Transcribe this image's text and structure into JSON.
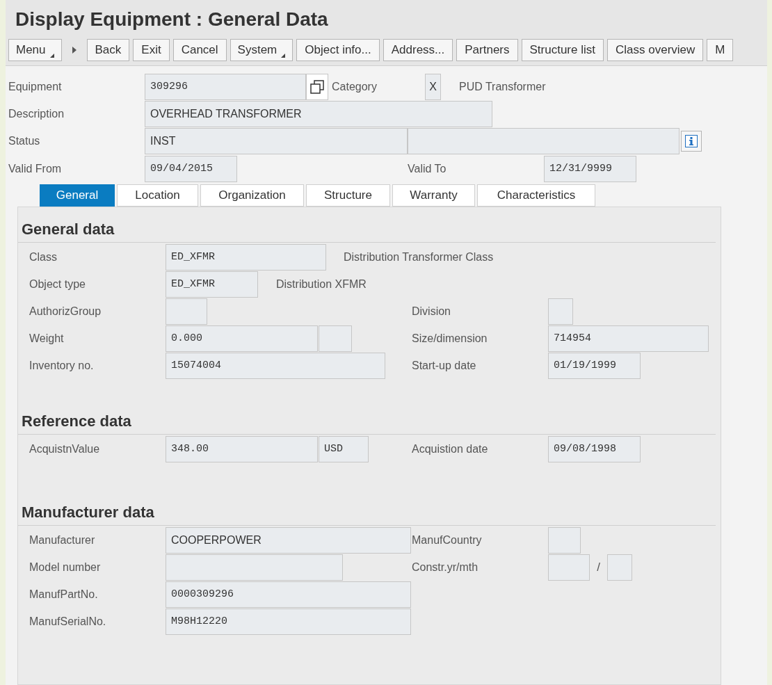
{
  "title": "Display Equipment : General Data",
  "toolbar": [
    {
      "kind": "menu",
      "label": "Menu"
    },
    {
      "kind": "arrow"
    },
    {
      "kind": "button",
      "label": "Back"
    },
    {
      "kind": "button",
      "label": "Exit"
    },
    {
      "kind": "button",
      "label": "Cancel"
    },
    {
      "kind": "menu",
      "label": "System"
    },
    {
      "kind": "button",
      "label": "Object info..."
    },
    {
      "kind": "button",
      "label": "Address..."
    },
    {
      "kind": "button",
      "label": "Partners"
    },
    {
      "kind": "button",
      "label": "Structure list"
    },
    {
      "kind": "button",
      "label": "Class overview"
    },
    {
      "kind": "button",
      "label": "M"
    }
  ],
  "header": {
    "equipment": {
      "label": "Equipment",
      "value": "309296"
    },
    "category": {
      "label": "Category",
      "value": "X",
      "text": "PUD Transformer"
    },
    "description": {
      "label": "Description",
      "value": "OVERHEAD TRANSFORMER"
    },
    "status": {
      "label": "Status",
      "value": "INST"
    },
    "valid_from": {
      "label": "Valid From",
      "value": "09/04/2015"
    },
    "valid_to": {
      "label": "Valid To",
      "value": "12/31/9999"
    }
  },
  "tabs": [
    {
      "label": "General",
      "selected": true
    },
    {
      "label": "Location",
      "selected": false
    },
    {
      "label": "Organization",
      "selected": false
    },
    {
      "label": "Structure",
      "selected": false
    },
    {
      "label": "Warranty",
      "selected": false
    },
    {
      "label": "Characteristics",
      "selected": false
    }
  ],
  "general_data": {
    "title": "General data",
    "class": {
      "label": "Class",
      "value": "ED_XFMR",
      "text": "Distribution Transformer Class"
    },
    "object_type": {
      "label": "Object type",
      "value": "ED_XFMR",
      "text": "Distribution XFMR"
    },
    "authoriz_group": {
      "label": "AuthorizGroup"
    },
    "division": {
      "label": "Division"
    },
    "weight": {
      "label": "Weight",
      "value": "0.000"
    },
    "size_dimension": {
      "label": "Size/dimension",
      "value": "714954"
    },
    "inventory_no": {
      "label": "Inventory no.",
      "value": "15074004"
    },
    "start_up_date": {
      "label": "Start-up date",
      "value": "01/19/1999"
    }
  },
  "reference_data": {
    "title": "Reference data",
    "acquisition_value": {
      "label": "AcquistnValue",
      "value": "348.00",
      "currency": "USD"
    },
    "acquisition_date": {
      "label": "Acquistion date",
      "value": "09/08/1998"
    }
  },
  "manufacturer_data": {
    "title": "Manufacturer data",
    "manufacturer": {
      "label": "Manufacturer",
      "value": "COOPERPOWER"
    },
    "manuf_country": {
      "label": "ManufCountry"
    },
    "model_number": {
      "label": "Model number"
    },
    "constr_yr_mth": {
      "label": "Constr.yr/mth",
      "separator": "/"
    },
    "manuf_part_no": {
      "label": "ManufPartNo.",
      "value": "0000309296"
    },
    "manuf_serial_no": {
      "label": "ManufSerialNo.",
      "value": "M98H12220"
    }
  }
}
